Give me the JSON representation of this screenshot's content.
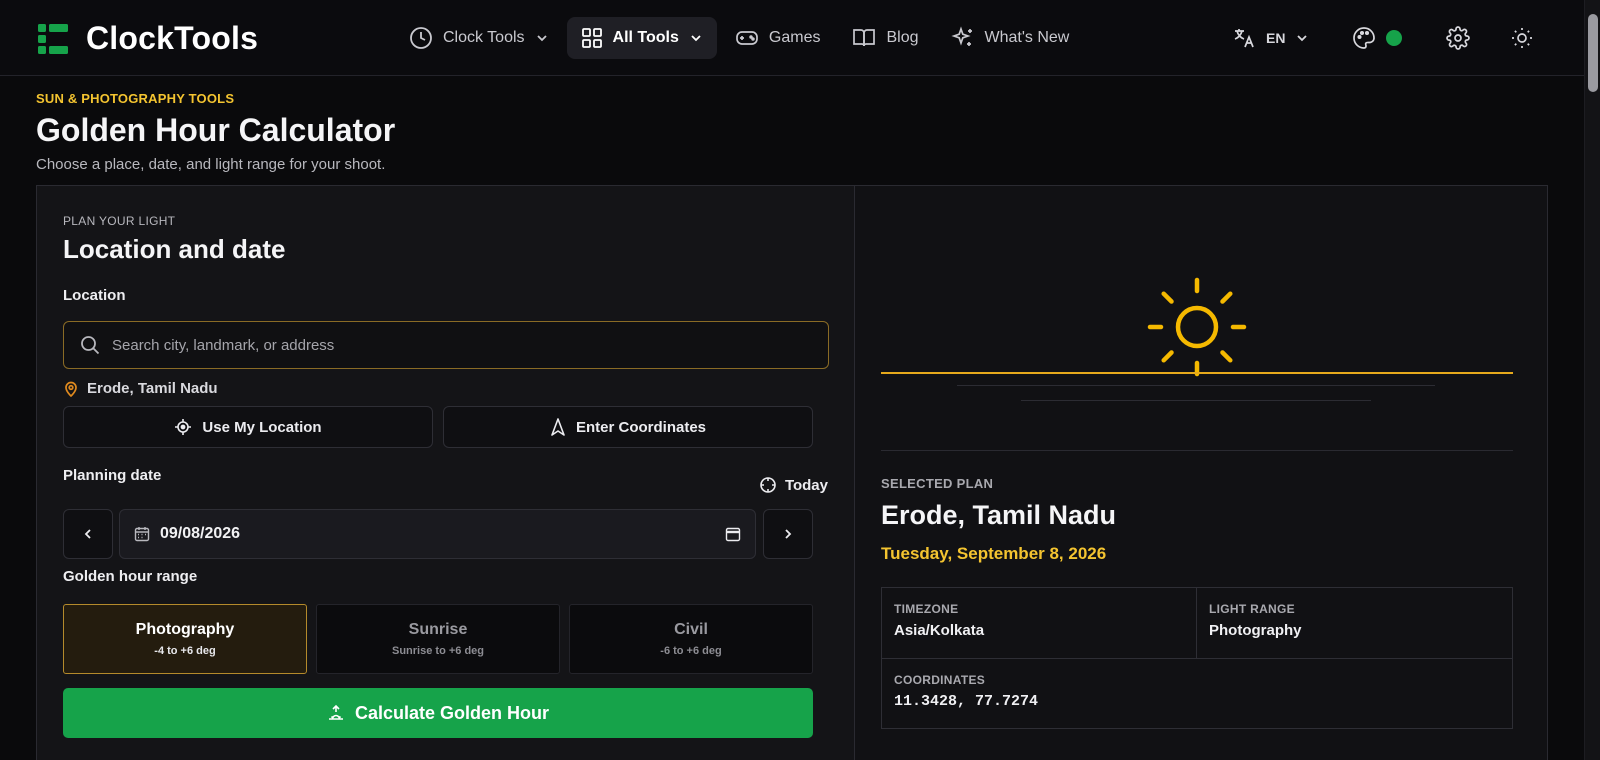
{
  "app": {
    "brand": "ClockTools",
    "accent_color": "#16a34a",
    "highlight_color": "#f4c430"
  },
  "nav": {
    "items": [
      {
        "label": "Clock Tools",
        "icon": "clock-icon",
        "dropdown": true
      },
      {
        "label": "All Tools",
        "icon": "grid-icon",
        "dropdown": true,
        "active": true
      },
      {
        "label": "Games",
        "icon": "gamepad-icon"
      },
      {
        "label": "Blog",
        "icon": "book-icon"
      },
      {
        "label": "What's New",
        "icon": "sparkles-icon"
      }
    ],
    "language": "EN",
    "status_dot_color": "#16a34a"
  },
  "page": {
    "eyebrow": "SUN & PHOTOGRAPHY TOOLS",
    "title": "Golden Hour Calculator",
    "subtitle": "Choose a place, date, and light range for your shoot."
  },
  "form": {
    "section_label": "PLAN YOUR LIGHT",
    "section_title": "Location and date",
    "location_label": "Location",
    "search_placeholder": "Search city, landmark, or address",
    "current_location": "Erode, Tamil Nadu",
    "use_location_label": "Use My Location",
    "enter_coordinates_label": "Enter Coordinates",
    "date_label": "Planning date",
    "today_label": "Today",
    "date_value": "09/08/2026",
    "range_label": "Golden hour range",
    "ranges": [
      {
        "title": "Photography",
        "sub": "-4 to +6 deg",
        "selected": true
      },
      {
        "title": "Sunrise",
        "sub": "Sunrise to +6 deg",
        "selected": false
      },
      {
        "title": "Civil",
        "sub": "-6 to +6 deg",
        "selected": false
      }
    ],
    "calculate_label": "Calculate Golden Hour"
  },
  "plan": {
    "label": "SELECTED PLAN",
    "place": "Erode, Tamil Nadu",
    "date": "Tuesday, September 8, 2026",
    "timezone_label": "TIMEZONE",
    "timezone": "Asia/Kolkata",
    "light_range_label": "LIGHT RANGE",
    "light_range": "Photography",
    "coordinates_label": "COORDINATES",
    "coordinates": "11.3428, 77.7274"
  }
}
